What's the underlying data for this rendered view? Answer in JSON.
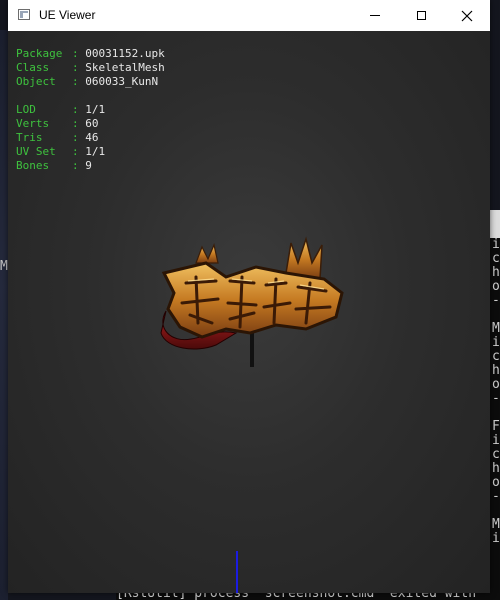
{
  "window": {
    "title": "UE Viewer",
    "controls": {
      "minimize": "minimize",
      "maximize": "maximize",
      "close": "close"
    }
  },
  "info": {
    "package_label": "Package",
    "package": "00031152.upk",
    "class_label": "Class",
    "class": "SkeletalMesh",
    "object_label": "Object",
    "object": "060033_KunN",
    "lod_label": "LOD",
    "lod": "1/1",
    "verts_label": "Verts",
    "verts": "60",
    "tris_label": "Tris",
    "tris": "46",
    "uvset_label": "UV Set",
    "uvset": "1/1",
    "bones_label": "Bones",
    "bones": "9"
  },
  "console": {
    "lines": [
      "i",
      "c",
      "h",
      "o",
      "-",
      "",
      "M",
      "i",
      "c",
      "h",
      "o",
      "-",
      "",
      "F",
      "i",
      "c",
      "h",
      "o",
      "-",
      "",
      "M",
      "i"
    ],
    "bottom": "[RstUtil] process \"screenshot.cmd\" exited with",
    "left_char": "M"
  },
  "colors": {
    "label_green": "#3ec23e",
    "value_white": "#e8e8e8",
    "viewport_bg": "#2d2d2d",
    "axis_blue": "#1c1ce0"
  }
}
